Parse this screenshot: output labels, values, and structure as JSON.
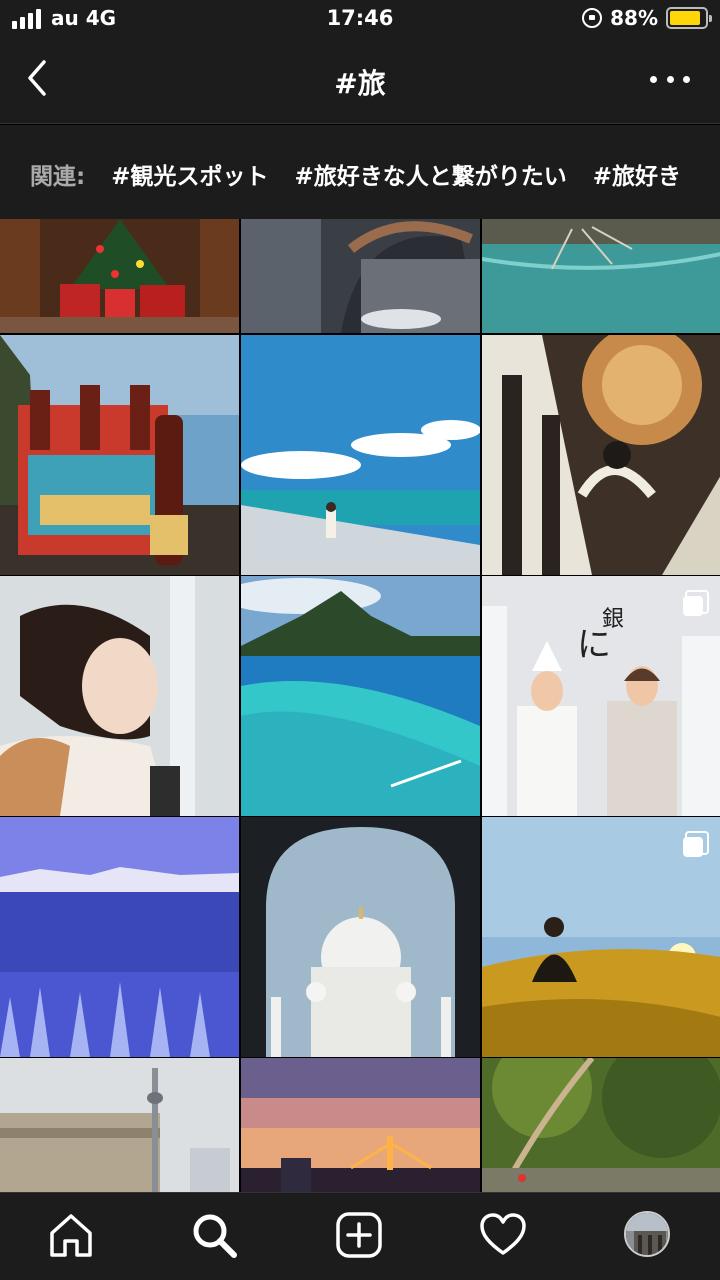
{
  "status": {
    "carrier": "au 4G",
    "time": "17:46",
    "battery_percent": "88%",
    "battery_level": 0.88,
    "battery_color": "#ffd60a"
  },
  "header": {
    "title": "#旅",
    "back_icon": "chevron-left-icon",
    "more_icon": "more-horizontal-icon"
  },
  "related": {
    "label": "関連:",
    "tags": [
      "#観光スポット",
      "#旅好きな人と繋がりたい",
      "#旅好き"
    ]
  },
  "grid": {
    "posts": [
      {
        "id": "christmas-tree",
        "multi": false
      },
      {
        "id": "canal-bridge",
        "multi": false
      },
      {
        "id": "river-water",
        "multi": false
      },
      {
        "id": "longboard-beer",
        "multi": false
      },
      {
        "id": "beach-woman",
        "multi": false
      },
      {
        "id": "cathedral-interior",
        "multi": false
      },
      {
        "id": "woman-portrait",
        "multi": false
      },
      {
        "id": "bora-bora-lagoon",
        "multi": false
      },
      {
        "id": "ginza-shop",
        "multi": true
      },
      {
        "id": "snowy-mountains",
        "multi": false
      },
      {
        "id": "white-mosque",
        "multi": false
      },
      {
        "id": "desert-dune",
        "multi": true
      },
      {
        "id": "cn-tower",
        "multi": false
      },
      {
        "id": "rainbow-bridge",
        "multi": false
      },
      {
        "id": "jungle-trees",
        "multi": false
      }
    ]
  },
  "tabbar": {
    "items": [
      "home-icon",
      "search-icon",
      "add-post-icon",
      "activity-heart-icon",
      "profile-avatar"
    ]
  },
  "colors": {
    "bar_background": "#1c1c1c",
    "text": "#ffffff",
    "muted": "#aaaaaa"
  }
}
